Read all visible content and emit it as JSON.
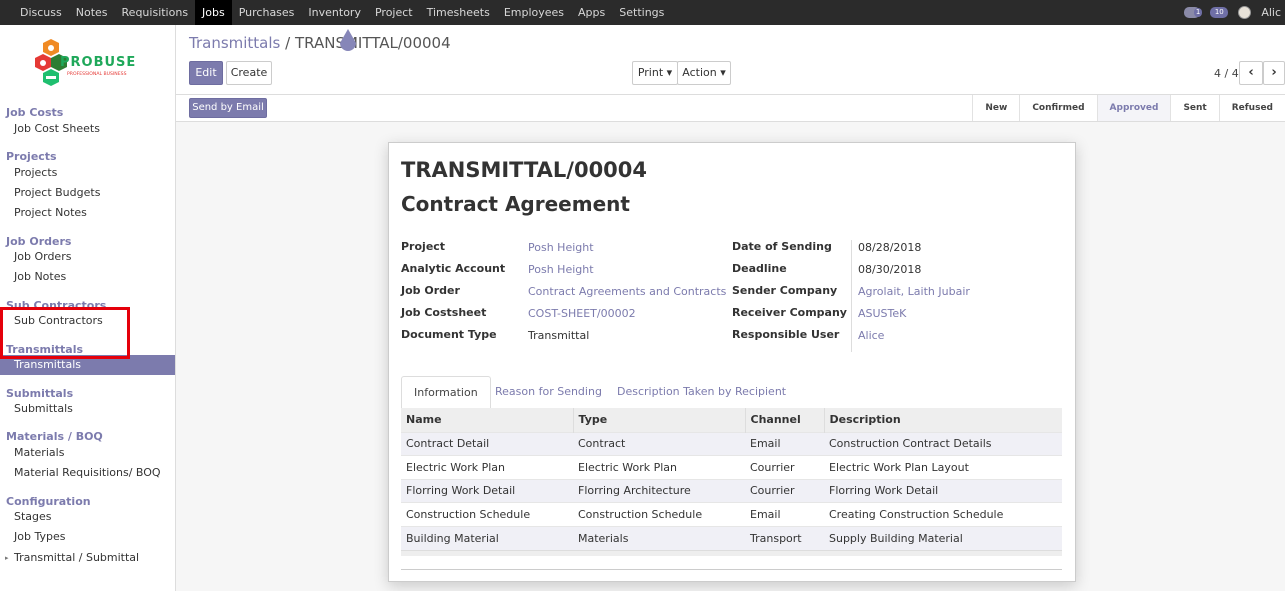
{
  "top_menu": [
    "Discuss",
    "Notes",
    "Requisitions",
    "Jobs",
    "Purchases",
    "Inventory",
    "Project",
    "Timesheets",
    "Employees",
    "Apps",
    "Settings"
  ],
  "top_menu_active": "Jobs",
  "systray": {
    "chat_count": "1",
    "activity_count": "10",
    "user": "Alic"
  },
  "logo": {
    "name": "PROBUSE",
    "tagline": "PROFESSIONAL BUSINESS"
  },
  "sidebar": {
    "sections": [
      {
        "title": "Job Costs",
        "items": [
          "Job Cost Sheets"
        ]
      },
      {
        "title": "Projects",
        "items": [
          "Projects",
          "Project Budgets",
          "Project Notes"
        ]
      },
      {
        "title": "Job Orders",
        "items": [
          "Job Orders",
          "Job Notes"
        ]
      },
      {
        "title": "Sub Contractors",
        "items": [
          "Sub Contractors"
        ]
      },
      {
        "title": "Transmittals",
        "items": [
          "Transmittals"
        ]
      },
      {
        "title": "Submittals",
        "items": [
          "Submittals"
        ]
      },
      {
        "title": "Materials / BOQ",
        "items": [
          "Materials",
          "Material Requisitions/ BOQ"
        ]
      },
      {
        "title": "Configuration",
        "items": [
          "Stages",
          "Job Types",
          "Transmittal / Submittal"
        ]
      }
    ],
    "active_item": "Transmittals"
  },
  "breadcrumb": {
    "parent": "Transmittals",
    "separator": "/",
    "current": "TRANSMITTAL/00004"
  },
  "buttons": {
    "edit": "Edit",
    "create": "Create",
    "print": "Print",
    "action": "Action",
    "send_email": "Send by Email"
  },
  "pager": {
    "text": "4 / 4"
  },
  "stages": [
    "New",
    "Confirmed",
    "Approved",
    "Sent",
    "Refused"
  ],
  "current_stage": "Approved",
  "record": {
    "reference": "TRANSMITTAL/00004",
    "name": "Contract Agreement",
    "left_fields": [
      {
        "label": "Project",
        "value": "Posh Height",
        "link": true
      },
      {
        "label": "Analytic Account",
        "value": "Posh Height",
        "link": true
      },
      {
        "label": "Job Order",
        "value": "Contract Agreements and Contracts",
        "link": true
      },
      {
        "label": "Job Costsheet",
        "value": "COST-SHEET/00002",
        "link": true
      },
      {
        "label": "Document Type",
        "value": "Transmittal",
        "link": false
      }
    ],
    "right_fields": [
      {
        "label": "Date of Sending",
        "value": "08/28/2018",
        "link": false
      },
      {
        "label": "Deadline",
        "value": "08/30/2018",
        "link": false
      },
      {
        "label": "Sender Company",
        "value": "Agrolait, Laith Jubair",
        "link": true
      },
      {
        "label": "Receiver Company",
        "value": "ASUSTeK",
        "link": true
      },
      {
        "label": "Responsible User",
        "value": "Alice",
        "link": true
      }
    ]
  },
  "tabs": [
    "Information",
    "Reason for Sending",
    "Description Taken by Recipient"
  ],
  "active_tab": "Information",
  "table": {
    "columns": [
      "Name",
      "Type",
      "Channel",
      "Description"
    ],
    "rows": [
      [
        "Contract Detail",
        "Contract",
        "Email",
        "Construction Contract Details"
      ],
      [
        "Electric Work Plan",
        "Electric Work Plan",
        "Courrier",
        "Electric Work Plan Layout"
      ],
      [
        "Florring Work Detail",
        "Florring Architecture",
        "Courrier",
        "Florring Work Detail"
      ],
      [
        "Construction Schedule",
        "Construction Schedule",
        "Email",
        "Creating Construction Schedule"
      ],
      [
        "Building Material",
        "Materials",
        "Transport",
        "Supply Building Material"
      ]
    ]
  },
  "colors": {
    "accent": "#7c7bad",
    "topbar": "#2b2b2b",
    "highlight": "#e5000b"
  }
}
